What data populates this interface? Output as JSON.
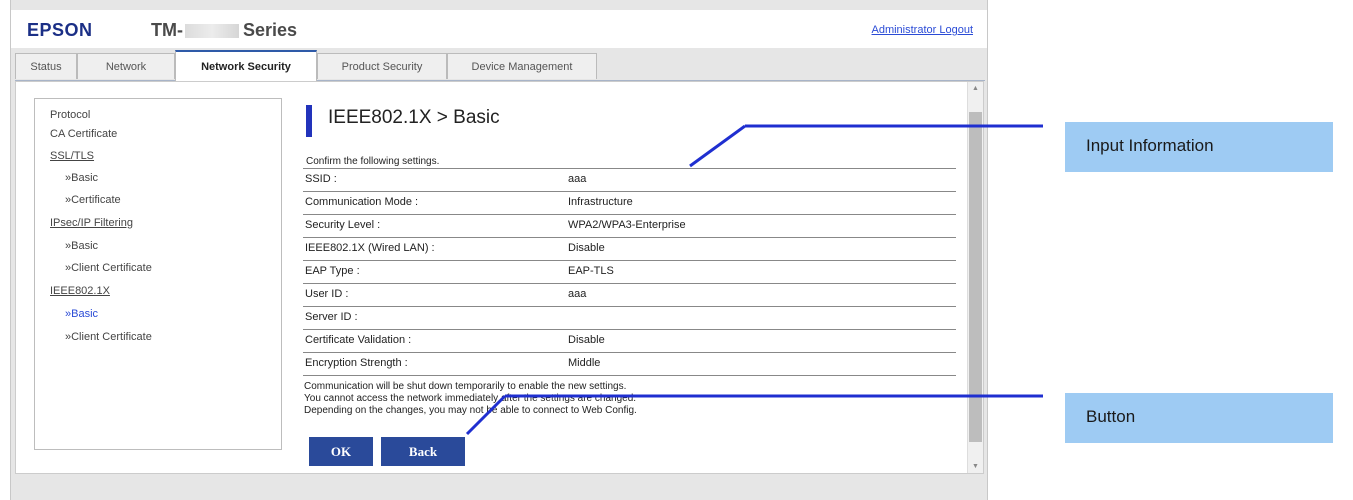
{
  "header": {
    "logo": "EPSON",
    "model_prefix": "TM-",
    "model_suffix": "Series",
    "logout": "Administrator Logout"
  },
  "tabs": [
    {
      "label": "Status"
    },
    {
      "label": "Network"
    },
    {
      "label": "Network Security",
      "active": true
    },
    {
      "label": "Product Security"
    },
    {
      "label": "Device Management"
    }
  ],
  "sidebar": {
    "protocol": "Protocol",
    "ca_certificate": "CA Certificate",
    "ssl_tls": "SSL/TLS",
    "ssl_basic": "»Basic",
    "ssl_certificate": "»Certificate",
    "ipsec": "IPsec/IP Filtering",
    "ipsec_basic": "»Basic",
    "ipsec_client_cert": "»Client Certificate",
    "ieee": "IEEE802.1X",
    "ieee_basic": "»Basic",
    "ieee_client_cert": "»Client Certificate"
  },
  "main": {
    "title": "IEEE802.1X > Basic",
    "confirm": "Confirm the following settings.",
    "rows": [
      {
        "label": "SSID :",
        "value": "aaa"
      },
      {
        "label": "Communication Mode :",
        "value": "Infrastructure"
      },
      {
        "label": "Security Level :",
        "value": "WPA2/WPA3-Enterprise"
      },
      {
        "label": "IEEE802.1X (Wired LAN) :",
        "value": "Disable"
      },
      {
        "label": "EAP Type :",
        "value": "EAP-TLS"
      },
      {
        "label": "User ID :",
        "value": "aaa"
      },
      {
        "label": "Server ID :",
        "value": ""
      },
      {
        "label": "Certificate Validation :",
        "value": "Disable"
      },
      {
        "label": "Encryption Strength :",
        "value": "Middle"
      }
    ],
    "notes": [
      "Communication will be shut down temporarily to enable the new settings.",
      "You cannot access the network immediately after the settings are changed.",
      "Depending on the changes, you may not be able to connect to Web Config."
    ],
    "ok_label": "OK",
    "back_label": "Back"
  },
  "callouts": {
    "input_info": "Input Information",
    "button": "Button"
  },
  "colors": {
    "accent": "#2233bb",
    "button": "#2a4a9a",
    "callout": "#9ecbf3"
  }
}
